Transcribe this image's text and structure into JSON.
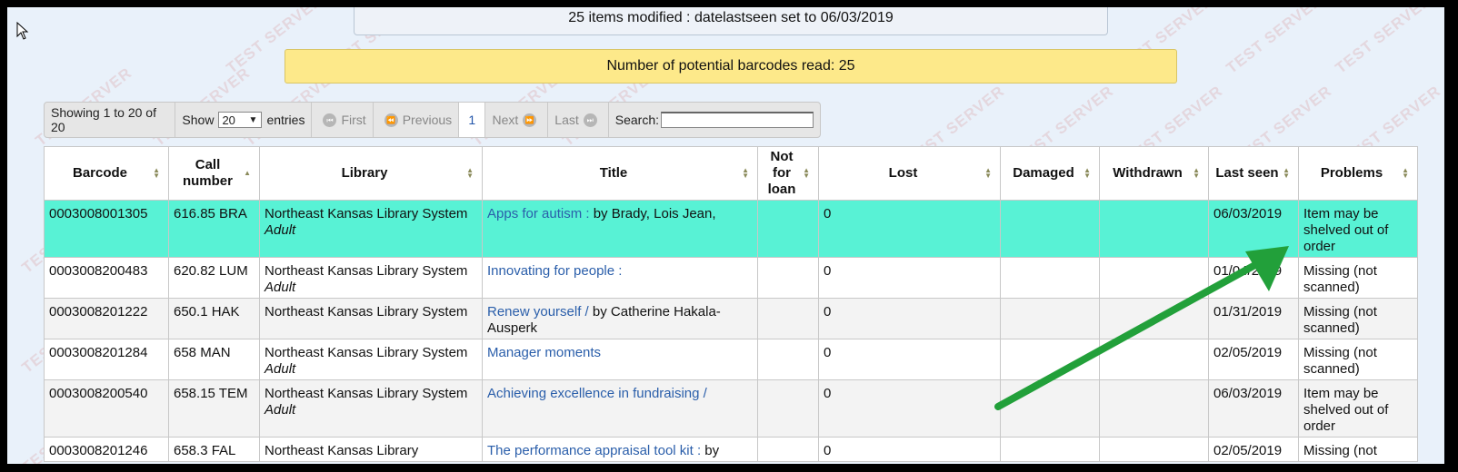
{
  "watermark": "TEST SERVER",
  "messages": {
    "modified": "25 items modified : datelastseen set to 06/03/2019",
    "barcodes": "Number of potential barcodes read: 25"
  },
  "toolbar": {
    "showing": "Showing 1 to 20 of 20",
    "show_label": "Show",
    "entries_value": "20",
    "entries_label": "entries",
    "first": "First",
    "previous": "Previous",
    "page": "1",
    "next": "Next",
    "last": "Last",
    "search_label": "Search:",
    "search_value": ""
  },
  "table": {
    "headers": {
      "barcode": "Barcode",
      "call_number": "Call number",
      "library": "Library",
      "title": "Title",
      "not_for_loan": "Not for loan",
      "lost": "Lost",
      "damaged": "Damaged",
      "withdrawn": "Withdrawn",
      "last_seen": "Last seen",
      "problems": "Problems"
    },
    "rows": [
      {
        "barcode": "0003008001305",
        "call": "616.85 BRA",
        "library": "Northeast Kansas Library System",
        "library_type": "Adult",
        "title": "Apps for autism :",
        "author": "by Brady, Lois Jean,",
        "nfl": "",
        "lost": "0",
        "damaged": "",
        "withdrawn": "",
        "last_seen": "06/03/2019",
        "problem": "Item may be shelved out of order"
      },
      {
        "barcode": "0003008200483",
        "call": "620.82 LUM",
        "library": "Northeast Kansas Library System",
        "library_type": "Adult",
        "title": "Innovating for people :",
        "author": "",
        "nfl": "",
        "lost": "0",
        "damaged": "",
        "withdrawn": "",
        "last_seen": "01/04/2019",
        "problem": "Missing (not scanned)"
      },
      {
        "barcode": "0003008201222",
        "call": "650.1 HAK",
        "library": "Northeast Kansas Library System",
        "library_type": "",
        "title": "Renew yourself /",
        "author": "by Catherine Hakala-Ausperk",
        "nfl": "",
        "lost": "0",
        "damaged": "",
        "withdrawn": "",
        "last_seen": "01/31/2019",
        "problem": "Missing (not scanned)"
      },
      {
        "barcode": "0003008201284",
        "call": "658 MAN",
        "library": "Northeast Kansas Library System",
        "library_type": "Adult",
        "title": "Manager moments",
        "author": "",
        "nfl": "",
        "lost": "0",
        "damaged": "",
        "withdrawn": "",
        "last_seen": "02/05/2019",
        "problem": "Missing (not scanned)"
      },
      {
        "barcode": "0003008200540",
        "call": "658.15 TEM",
        "library": "Northeast Kansas Library System",
        "library_type": "Adult",
        "title": "Achieving excellence in fundraising /",
        "author": "",
        "nfl": "",
        "lost": "0",
        "damaged": "",
        "withdrawn": "",
        "last_seen": "06/03/2019",
        "problem": "Item may be shelved out of order"
      },
      {
        "barcode": "0003008201246",
        "call": "658.3 FAL",
        "library": "Northeast Kansas Library",
        "library_type": "",
        "title": "The performance appraisal tool kit :",
        "author": "by",
        "nfl": "",
        "lost": "0",
        "damaged": "",
        "withdrawn": "",
        "last_seen": "02/05/2019",
        "problem": "Missing (not"
      }
    ]
  },
  "colors": {
    "highlight": "#58f2d5",
    "arrow": "#22a03a",
    "notice": "#fde98a",
    "link": "#2a5eaa"
  },
  "icons": {
    "cursor": "mouse-pointer-icon",
    "first": "first-page-icon",
    "previous": "previous-page-icon",
    "next": "next-page-icon",
    "last": "last-page-icon",
    "sort": "sort-icon",
    "arrow": "green-arrow-annotation"
  }
}
